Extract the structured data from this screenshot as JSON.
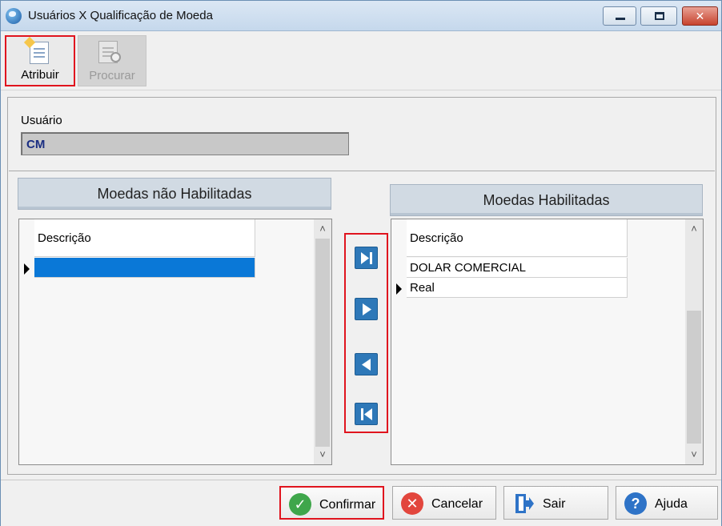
{
  "window": {
    "title": "Usuários X Qualificação de Moeda",
    "controls": {
      "minimize": "minimize-icon",
      "maximize": "maximize-icon",
      "close": "✕"
    }
  },
  "toolbar": {
    "atribuir_label": "Atribuir",
    "procurar_label": "Procurar"
  },
  "form": {
    "usuario_label": "Usuário",
    "usuario_value": "CM"
  },
  "left_list": {
    "title": "Moedas não Habilitadas",
    "column_header": "Descrição",
    "rows": [
      ""
    ]
  },
  "right_list": {
    "title": "Moedas Habilitadas",
    "column_header": "Descrição",
    "rows": [
      "DOLAR COMERCIAL",
      "Real"
    ]
  },
  "scroll_arrows": {
    "up": "˄",
    "down": "˅"
  },
  "move_buttons": [
    "move-all-right-icon",
    "move-right-icon",
    "move-left-icon",
    "move-all-left-icon"
  ],
  "footer": {
    "confirm_label": "Confirmar",
    "cancel_label": "Cancelar",
    "exit_label": "Sair",
    "help_label": "Ajuda"
  }
}
